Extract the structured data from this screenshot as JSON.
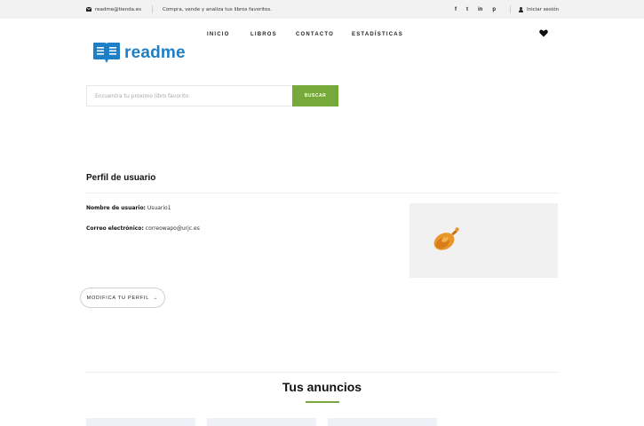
{
  "topbar": {
    "email": "readme@tienda.es",
    "tagline": "Compra, vende y analiza tus libros favoritos.",
    "social": [
      "f",
      "t",
      "in",
      "p"
    ],
    "login_label": "Iniciar sesión"
  },
  "brand": {
    "name": "readme",
    "color": "#1e7fc6"
  },
  "nav": {
    "items": [
      "INICIO",
      "LIBROS",
      "CONTACTO",
      "ESTADÍSTICAS"
    ]
  },
  "search": {
    "placeholder": "Encuentra tu proximo libro favorito",
    "button_label": "BUSCAR",
    "button_color": "#76a83a"
  },
  "profile": {
    "title": "Perfil de usuario",
    "username_label": "Nombre de usuario:",
    "username_value": "Usuario1",
    "email_label": "Correo electrónico:",
    "email_value": "correowapo@urjc.es",
    "modify_label": "MODIFICA TU PERFIL",
    "modify_arrow": "→"
  },
  "ads": {
    "title": "Tus anuncios"
  }
}
